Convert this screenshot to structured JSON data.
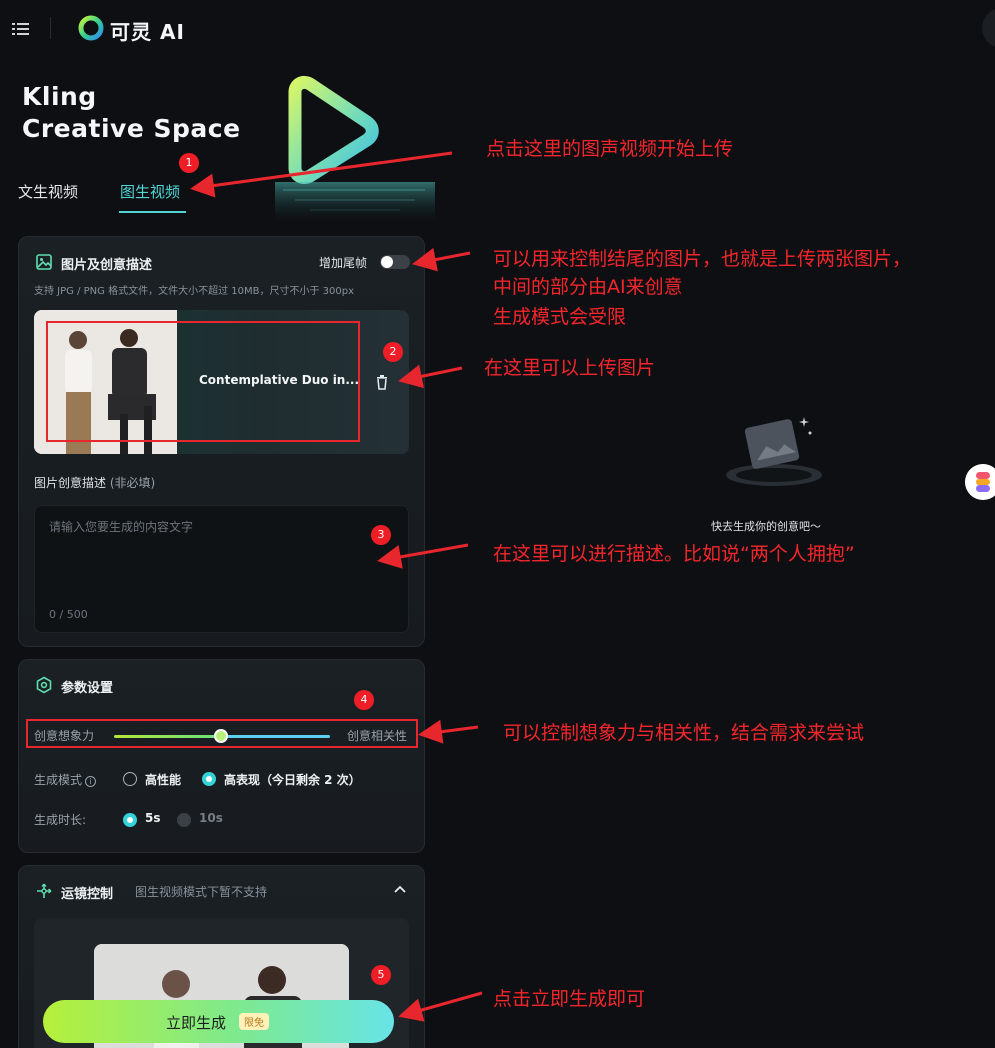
{
  "app": {
    "brand": "可灵 AI"
  },
  "hero": {
    "line1": "Kling",
    "line2": "Creative Space"
  },
  "tabs": [
    {
      "label": "文生视频",
      "active": false
    },
    {
      "label": "图生视频",
      "active": true
    }
  ],
  "image_panel": {
    "title": "图片及创意描述",
    "end_frame_label": "增加尾帧",
    "end_frame_enabled": false,
    "hint": "支持 JPG / PNG 格式文件，文件大小不超过 10MB，尺寸不小于 300px",
    "uploaded_file": "Contemplative Duo in...",
    "desc_label": "图片创意描述",
    "desc_optional": "(非必填)",
    "desc_placeholder": "请输入您要生成的内容文字",
    "desc_value": "",
    "desc_count": "0 / 500"
  },
  "params_panel": {
    "title": "参数设置",
    "slider_left": "创意想象力",
    "slider_right": "创意相关性",
    "slider_value": 0.5,
    "mode_label": "生成模式",
    "mode_options": [
      {
        "label": "高性能",
        "selected": false
      },
      {
        "label": "高表现（今日剩余 2 次）",
        "selected": true
      }
    ],
    "duration_label": "生成时长:",
    "duration_options": [
      {
        "label": "5s",
        "selected": true
      },
      {
        "label": "10s",
        "selected": false,
        "disabled": true
      }
    ]
  },
  "camera_panel": {
    "title": "运镜控制",
    "note": "图生视频模式下暂不支持"
  },
  "generate": {
    "label": "立即生成",
    "badge": "限免"
  },
  "empty_state": {
    "text": "快去生成你的创意吧～"
  },
  "annotations": [
    {
      "num": "1",
      "text": "点击这里的图声视频开始上传"
    },
    {
      "text": "可以用来控制结尾的图片，也就是上传两张图片，"
    },
    {
      "text": "中间的部分由AI来创意"
    },
    {
      "text": "生成模式会受限"
    },
    {
      "num": "2",
      "text": "在这里可以上传图片"
    },
    {
      "num": "3",
      "text": "在这里可以进行描述。比如说“两个人拥抱”"
    },
    {
      "num": "4",
      "text": "可以控制想象力与相关性，结合需求来尝试"
    },
    {
      "num": "5",
      "text": "点击立即生成即可"
    }
  ],
  "colors": {
    "accent": "#4fd6d4",
    "annotation": "#f5262b",
    "background": "#0d0f12"
  }
}
